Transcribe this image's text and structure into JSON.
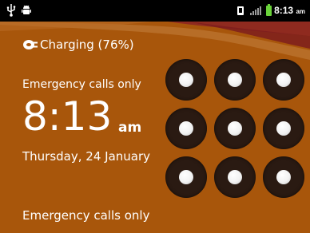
{
  "status_bar": {
    "time": "8:13",
    "ampm": "am",
    "icons": [
      "usb-icon",
      "android-icon",
      "sim-icon",
      "signal-icon",
      "battery-charging-icon"
    ]
  },
  "lock_screen": {
    "charging_text": "Charging (76%)",
    "emergency_top": "Emergency calls only",
    "clock_time": "8:13",
    "clock_ampm": "am",
    "date": "Thursday, 24 January",
    "emergency_bottom": "Emergency calls only"
  },
  "pattern_lock": {
    "rows": 3,
    "cols": 3
  },
  "colors": {
    "background": "#a8560b",
    "status_bar": "#000000",
    "dot_ring": "#2a1a12",
    "battery": "#6ad33a",
    "wave_red": "#7e1d1d",
    "wave_light": "#c98a4a"
  }
}
